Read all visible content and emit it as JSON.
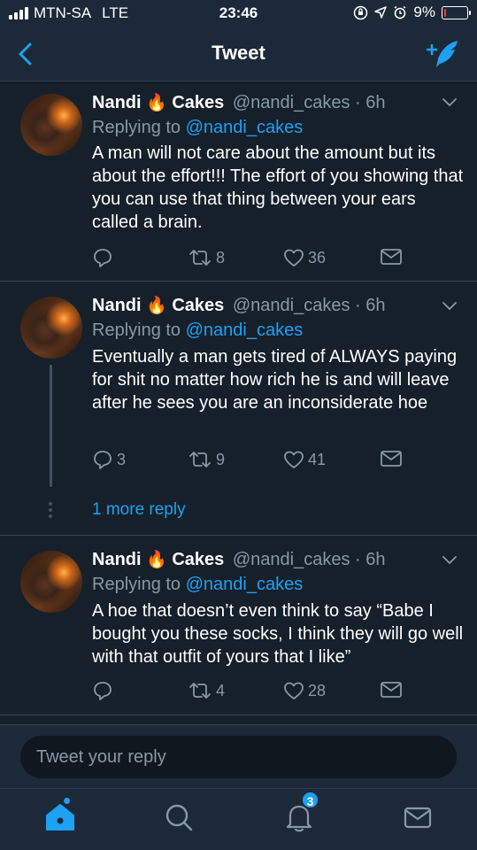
{
  "status_bar": {
    "carrier": "MTN-SA",
    "network": "LTE",
    "time": "23:46",
    "battery": "9%",
    "battery_level": 0.09,
    "battery_color": "#ff3b30"
  },
  "nav": {
    "title": "Tweet",
    "back_icon": "chevron-left-icon",
    "compose_icon": "compose-feather-icon"
  },
  "colors": {
    "background": "#15202b",
    "accent": "#1da1f2",
    "secondary_text": "#8899a6"
  },
  "tweets": [
    {
      "name_first": "Nandi",
      "emoji": "🔥",
      "name_last": "Cakes",
      "handle_time": "@nandi_cakes · 6h",
      "replying_prefix": "Replying to ",
      "replying_handle": "@nandi_cakes",
      "text": "A man will not care about the amount but its about the effort!!! The effort of you showing that you can use that thing between your ears called a brain.",
      "replies": "",
      "retweets": "8",
      "likes": "36"
    },
    {
      "name_first": "Nandi",
      "emoji": "🔥",
      "name_last": "Cakes",
      "handle_time": "@nandi_cakes · 6h",
      "replying_prefix": "Replying to ",
      "replying_handle": "@nandi_cakes",
      "text": "Eventually a man gets tired of ALWAYS paying for shit no matter how rich he is and will leave after he sees you are an inconsiderate hoe",
      "replies": "3",
      "retweets": "9",
      "likes": "41"
    },
    {
      "name_first": "Nandi",
      "emoji": "🔥",
      "name_last": "Cakes",
      "handle_time": "@nandi_cakes · 6h",
      "replying_prefix": "Replying to ",
      "replying_handle": "@nandi_cakes",
      "text": "A hoe that doesn’t even think to say “Babe I bought you these socks, I think they will go well with that outfit of yours that I like”",
      "replies": "",
      "retweets": "4",
      "likes": "28"
    }
  ],
  "more_replies": "1 more reply",
  "reply_box": {
    "placeholder": "Tweet your reply"
  },
  "tab_bar": {
    "tabs": [
      "home-icon",
      "search-icon",
      "notifications-icon",
      "messages-icon"
    ],
    "notifications_badge": "3"
  }
}
